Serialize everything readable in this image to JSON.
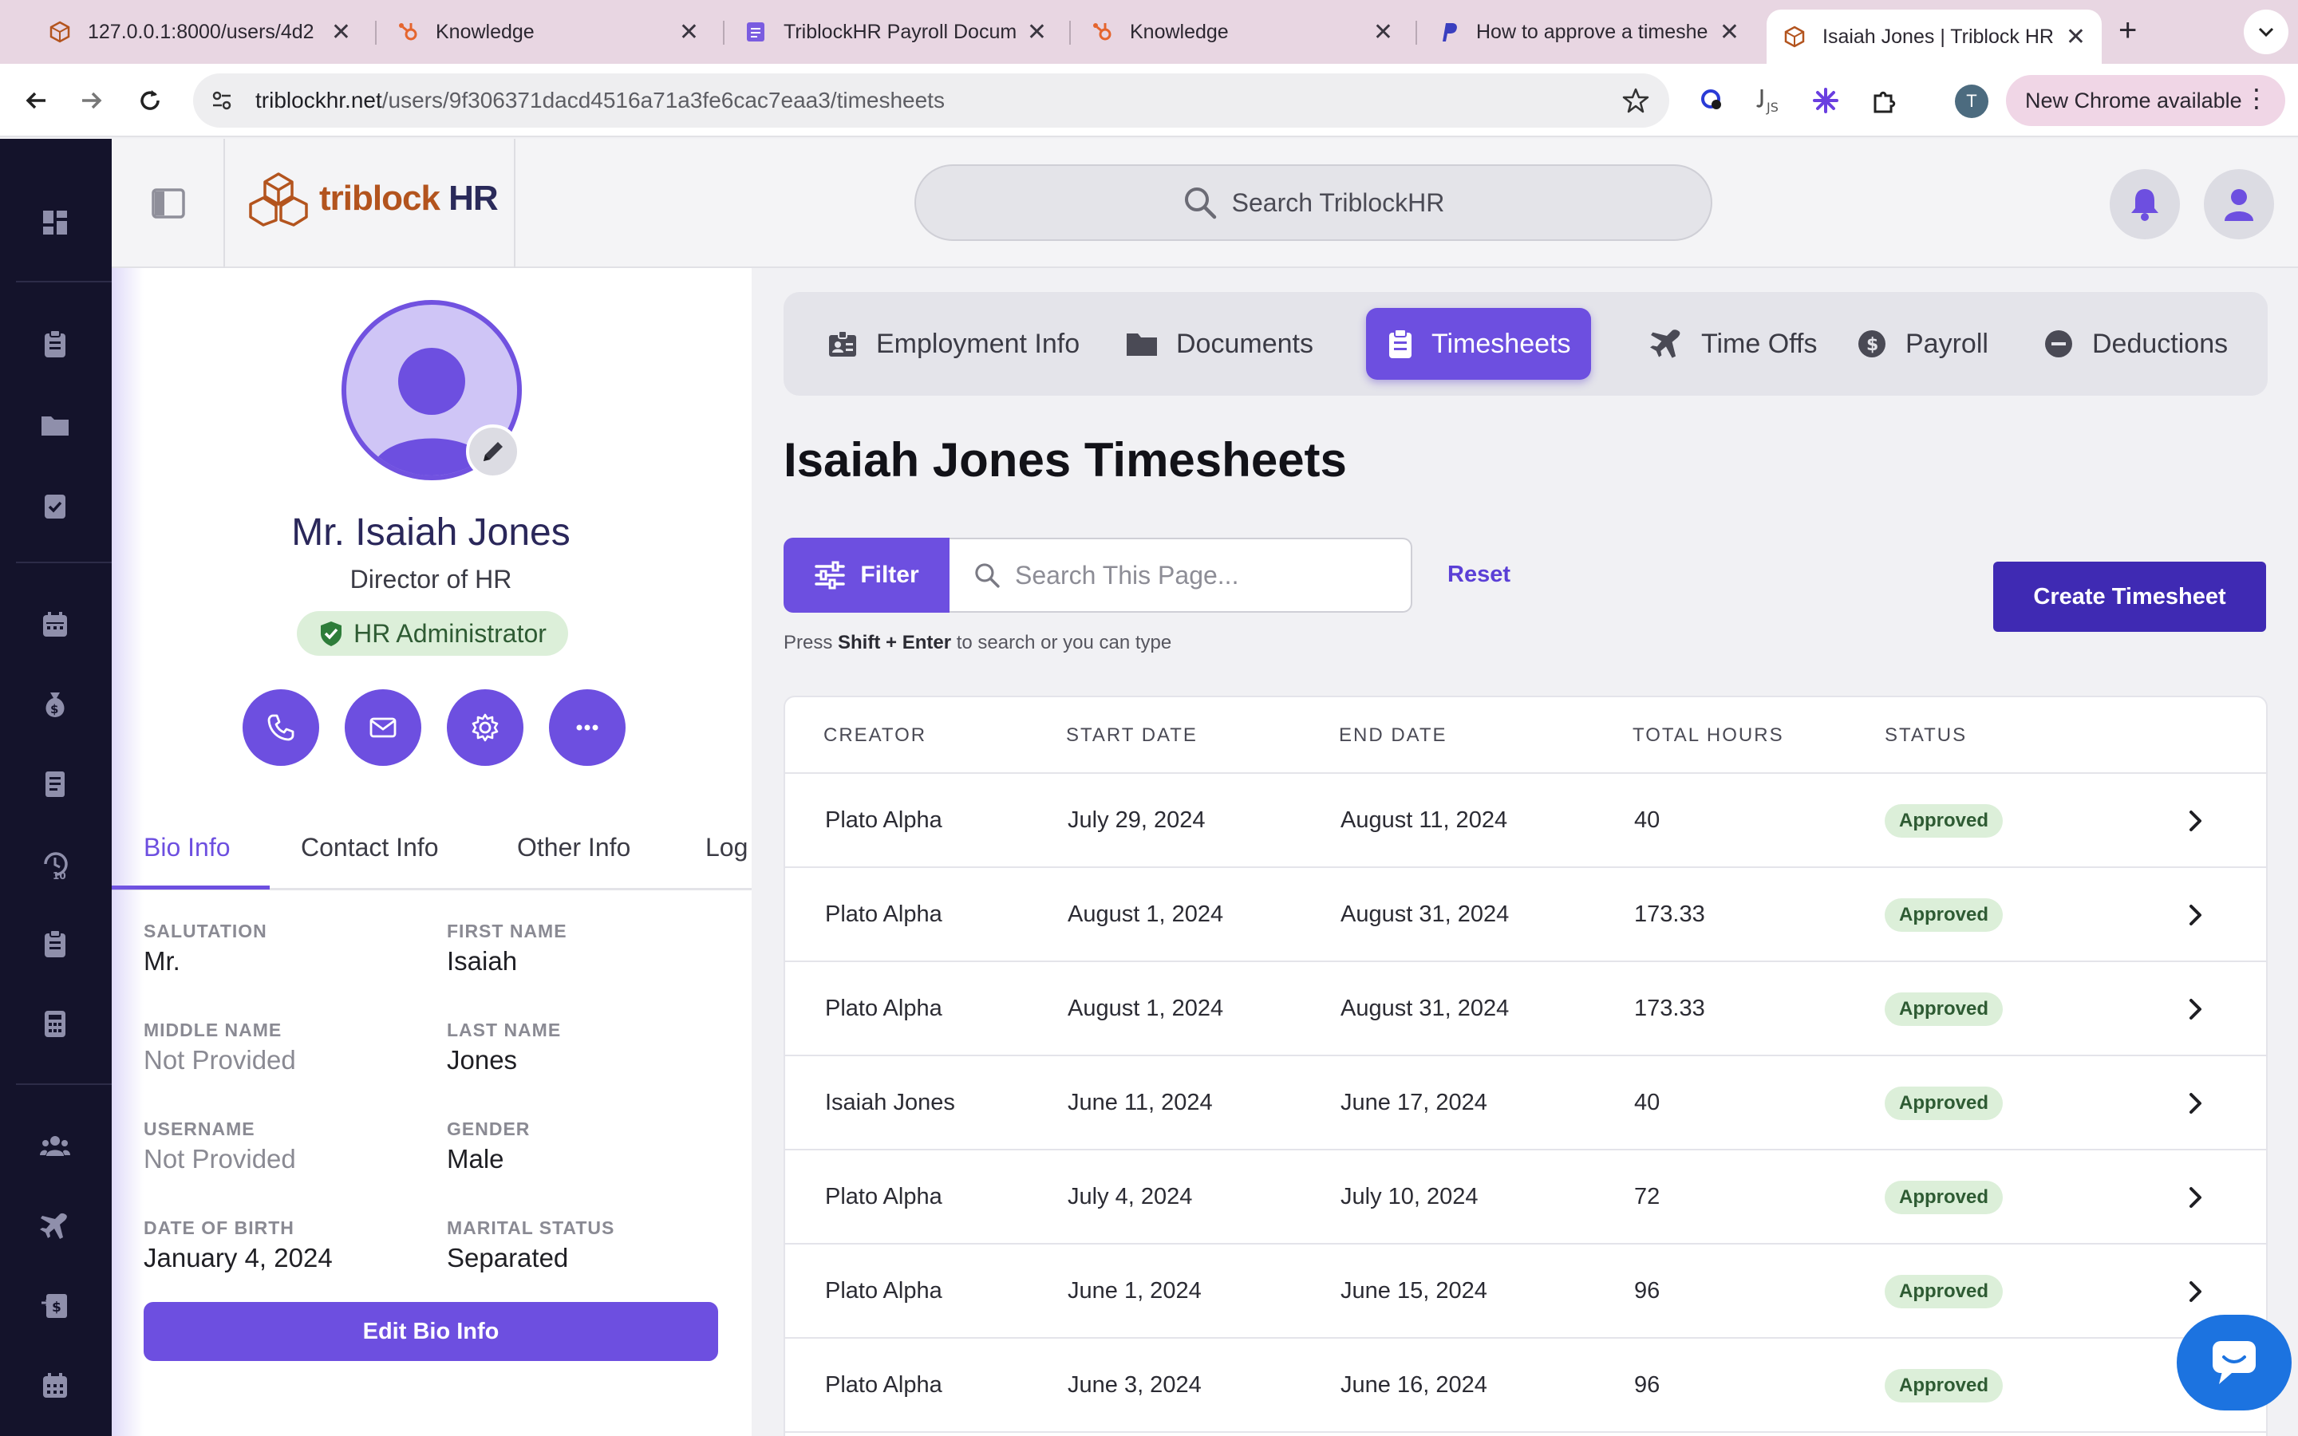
{
  "browser": {
    "tabs": [
      {
        "label": "127.0.0.1:8000/users/4d2",
        "icon": "triblock-icon"
      },
      {
        "label": "Knowledge",
        "icon": "hubspot-icon"
      },
      {
        "label": "TriblockHR Payroll Docum",
        "icon": "docs-icon"
      },
      {
        "label": "Knowledge",
        "icon": "hubspot-icon"
      },
      {
        "label": "How to approve a timeshe",
        "icon": "paypal-icon"
      },
      {
        "label": "Isaiah Jones | Triblock HR",
        "icon": "triblock-icon",
        "active": true
      }
    ],
    "close_glyph": "✕",
    "new_tab_glyph": "+",
    "url_host": "triblockhr.net",
    "url_path": "/users/9f306371dacd4516a71a3fe6cac7eaa3/timesheets",
    "profile_initial": "T",
    "update_label": "New Chrome available"
  },
  "header": {
    "logo_part1": "triblock",
    "logo_part2": "HR",
    "search_placeholder": "Search TriblockHR"
  },
  "profile": {
    "name": "Mr. Isaiah Jones",
    "title": "Director of HR",
    "role_badge": "HR Administrator",
    "tabs": [
      "Bio Info",
      "Contact Info",
      "Other Info",
      "Log"
    ],
    "fields": [
      {
        "label": "SALUTATION",
        "value": "Mr.",
        "muted": false
      },
      {
        "label": "FIRST NAME",
        "value": "Isaiah",
        "muted": false
      },
      {
        "label": "MIDDLE NAME",
        "value": "Not Provided",
        "muted": true
      },
      {
        "label": "LAST NAME",
        "value": "Jones",
        "muted": false
      },
      {
        "label": "USERNAME",
        "value": "Not Provided",
        "muted": true
      },
      {
        "label": "GENDER",
        "value": "Male",
        "muted": false
      },
      {
        "label": "DATE OF BIRTH",
        "value": "January 4, 2024",
        "muted": false
      },
      {
        "label": "MARITAL STATUS",
        "value": "Separated",
        "muted": false
      }
    ],
    "edit_label": "Edit Bio Info"
  },
  "main": {
    "tabs": [
      {
        "label": "Employment Info",
        "icon": "id-badge-icon"
      },
      {
        "label": "Documents",
        "icon": "folder-icon"
      },
      {
        "label": "Timesheets",
        "icon": "clipboard-icon",
        "active": true
      },
      {
        "label": "Time Offs",
        "icon": "plane-icon"
      },
      {
        "label": "Payroll",
        "icon": "dollar-icon"
      },
      {
        "label": "Deductions",
        "icon": "minus-circle-icon"
      }
    ],
    "page_title": "Isaiah Jones Timesheets",
    "filter_label": "Filter",
    "search_placeholder": "Search This Page...",
    "reset_label": "Reset",
    "create_label": "Create Timesheet",
    "hint_prefix": "Press ",
    "hint_keys": "Shift + Enter",
    "hint_suffix": " to search or you can type",
    "columns": [
      "CREATOR",
      "START DATE",
      "END DATE",
      "TOTAL HOURS",
      "STATUS"
    ],
    "rows": [
      {
        "creator": "Plato Alpha",
        "start": "July 29, 2024",
        "end": "August 11, 2024",
        "hours": "40",
        "status": "Approved"
      },
      {
        "creator": "Plato Alpha",
        "start": "August 1, 2024",
        "end": "August 31, 2024",
        "hours": "173.33",
        "status": "Approved"
      },
      {
        "creator": "Plato Alpha",
        "start": "August 1, 2024",
        "end": "August 31, 2024",
        "hours": "173.33",
        "status": "Approved"
      },
      {
        "creator": "Isaiah Jones",
        "start": "June 11, 2024",
        "end": "June 17, 2024",
        "hours": "40",
        "status": "Approved"
      },
      {
        "creator": "Plato Alpha",
        "start": "July 4, 2024",
        "end": "July 10, 2024",
        "hours": "72",
        "status": "Approved"
      },
      {
        "creator": "Plato Alpha",
        "start": "June 1, 2024",
        "end": "June 15, 2024",
        "hours": "96",
        "status": "Approved"
      },
      {
        "creator": "Plato Alpha",
        "start": "June 3, 2024",
        "end": "June 16, 2024",
        "hours": "96",
        "status": "Approved"
      }
    ]
  },
  "colors": {
    "accent": "#6d4fe0",
    "accent_dark": "#3f2ab3",
    "rail": "#14132b",
    "approved_bg": "#dcefd9",
    "approved_text": "#2e5b33"
  }
}
